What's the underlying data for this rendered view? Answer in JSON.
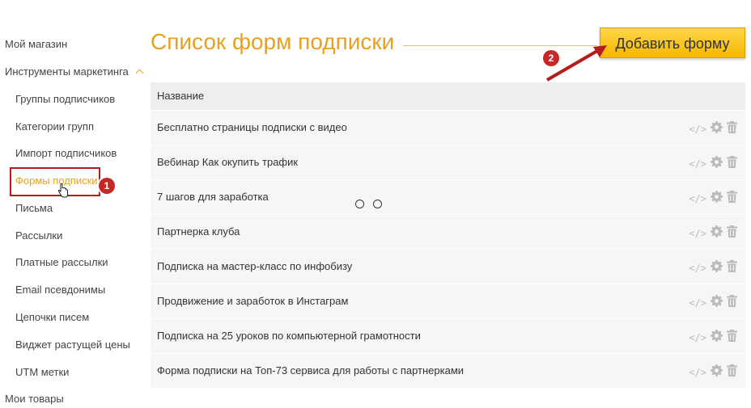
{
  "sidebar": {
    "items": [
      {
        "label": "Мой магазин"
      },
      {
        "label": "Инструменты маркетинга"
      },
      {
        "label": "Группы подписчиков"
      },
      {
        "label": "Категории групп"
      },
      {
        "label": "Импорт подписчиков"
      },
      {
        "label": "Формы подписки"
      },
      {
        "label": "Письма"
      },
      {
        "label": "Рассылки"
      },
      {
        "label": "Платные рассылки"
      },
      {
        "label": "Email псевдонимы"
      },
      {
        "label": "Цепочки писем"
      },
      {
        "label": "Виджет растущей цены"
      },
      {
        "label": "UTM метки"
      },
      {
        "label": "Мои товары"
      }
    ],
    "active_index": 5
  },
  "annotations": {
    "badge1": "1",
    "badge2": "2"
  },
  "main": {
    "title": "Список форм подписки",
    "add_button": "Добавить форму",
    "table": {
      "header": "Название",
      "rows": [
        {
          "name": "Бесплатно страницы подписки с видео"
        },
        {
          "name": "Вебинар Как окупить трафик"
        },
        {
          "name": "7 шагов для заработка"
        },
        {
          "name": "Партнерка клуба"
        },
        {
          "name": "Подписка на мастер-класс по инфобизу"
        },
        {
          "name": "Продвижение и заработок в Инстаграм"
        },
        {
          "name": "Подписка на 25 уроков по компьютерной грамотности"
        },
        {
          "name": "Форма подписки на Топ-73 сервиса для работы с партнерками"
        }
      ],
      "row_icons": [
        "code-icon",
        "gear-icon",
        "trash-icon"
      ]
    }
  },
  "colors": {
    "accent": "#e8a020",
    "button": "#f5b800",
    "annotation": "#c62828"
  }
}
